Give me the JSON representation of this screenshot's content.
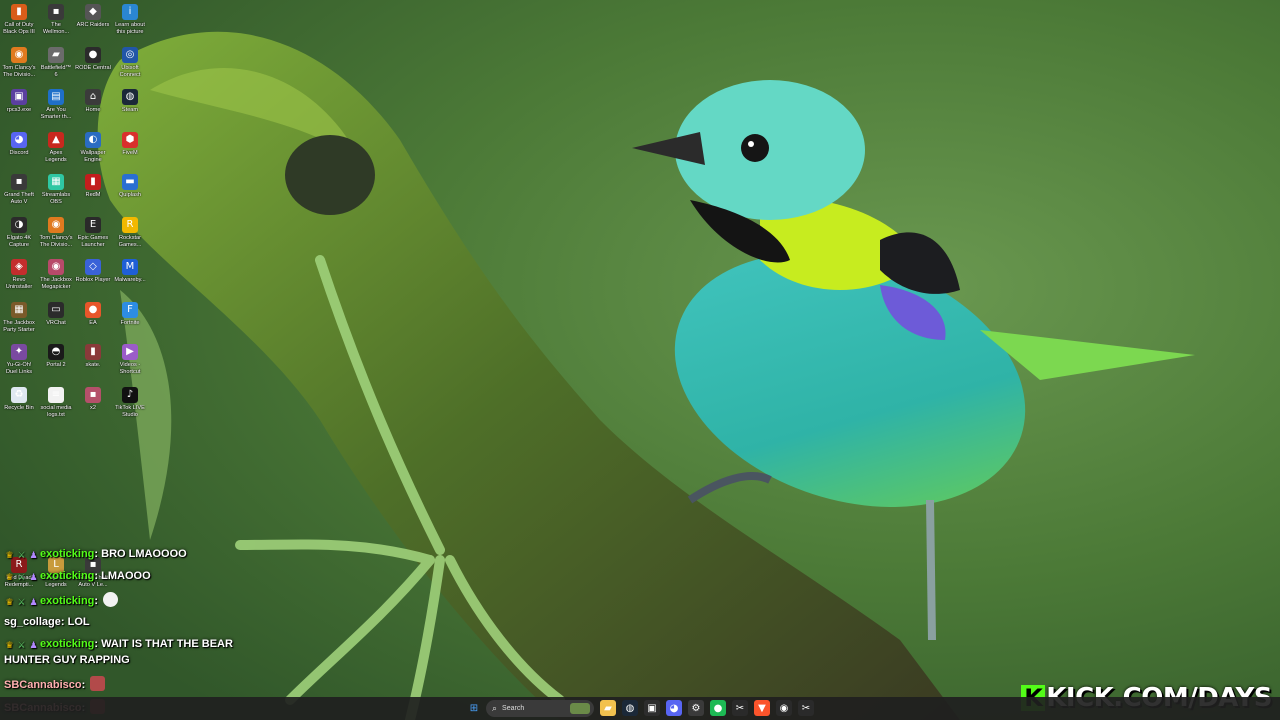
{
  "desktop": {
    "icons": [
      {
        "label": "Call of Duty\nBlack Ops III",
        "icon": "game-icon",
        "color": "#d95d1a",
        "glyph": "▮"
      },
      {
        "label": "The\nWellmon...",
        "icon": "app-icon",
        "color": "#3a3a3a",
        "glyph": "▪"
      },
      {
        "label": "ARC Raiders",
        "icon": "game-icon",
        "color": "#555555",
        "glyph": "◆"
      },
      {
        "label": "Learn about\nthis picture",
        "icon": "info-icon",
        "color": "#2a86d1",
        "glyph": "i"
      },
      {
        "label": "Tom Clancy's\nThe Divisio...",
        "icon": "game-icon",
        "color": "#e07a1f",
        "glyph": "◉"
      },
      {
        "label": "Battlefield™\n6",
        "icon": "game-icon",
        "color": "#6b6b6b",
        "glyph": "▰"
      },
      {
        "label": "RODE Central",
        "icon": "microphone-icon",
        "color": "#2b2b2b",
        "glyph": "●"
      },
      {
        "label": "Ubisoft\nConnect",
        "icon": "ubisoft-icon",
        "color": "#2156a8",
        "glyph": "◎"
      },
      {
        "label": "rpcs3.exe",
        "icon": "app-icon",
        "color": "#5b3fa0",
        "glyph": "▣"
      },
      {
        "label": "Are You\nSmarter th...",
        "icon": "game-icon",
        "color": "#1f6fc9",
        "glyph": "▤"
      },
      {
        "label": "Home",
        "icon": "game-icon",
        "color": "#3b3b3b",
        "glyph": "⌂"
      },
      {
        "label": "Steam",
        "icon": "steam-icon",
        "color": "#1b2838",
        "glyph": "◍"
      },
      {
        "label": "Discord",
        "icon": "discord-icon",
        "color": "#5865f2",
        "glyph": "◕"
      },
      {
        "label": "Apex\nLegends",
        "icon": "game-icon",
        "color": "#c8281e",
        "glyph": "▲"
      },
      {
        "label": "Wallpaper\nEngine",
        "icon": "app-icon",
        "color": "#2a6cc2",
        "glyph": "◐"
      },
      {
        "label": "FiveM",
        "icon": "game-icon",
        "color": "#d9302c",
        "glyph": "⬢"
      },
      {
        "label": "Grand Theft\nAuto V",
        "icon": "game-icon",
        "color": "#3a3a3a",
        "glyph": "▪"
      },
      {
        "label": "Streamlabs\nOBS",
        "icon": "streamlabs-icon",
        "color": "#2fc7a3",
        "glyph": "▦"
      },
      {
        "label": "RedM",
        "icon": "game-icon",
        "color": "#c21d1d",
        "glyph": "▮"
      },
      {
        "label": "Quiplash",
        "icon": "game-icon",
        "color": "#2a6fd1",
        "glyph": "▬"
      },
      {
        "label": "Elgato 4K\nCapture",
        "icon": "camera-icon",
        "color": "#2b2b2b",
        "glyph": "◑"
      },
      {
        "label": "Tom Clancy's\nThe Divisio...",
        "icon": "game-icon",
        "color": "#e07a1f",
        "glyph": "◉"
      },
      {
        "label": "Epic Games\nLauncher",
        "icon": "epic-icon",
        "color": "#2a2a2a",
        "glyph": "E"
      },
      {
        "label": "Rockstar\nGames...",
        "icon": "rockstar-icon",
        "color": "#f2b800",
        "glyph": "R"
      },
      {
        "label": "Revo\nUninstaller",
        "icon": "app-icon",
        "color": "#c42d2d",
        "glyph": "◈"
      },
      {
        "label": "The Jackbox\nMegapicker",
        "icon": "game-icon",
        "color": "#b84a6a",
        "glyph": "◉"
      },
      {
        "label": "Roblox Player",
        "icon": "roblox-icon",
        "color": "#3a62d8",
        "glyph": "◇"
      },
      {
        "label": "Malwareby...",
        "icon": "shield-icon",
        "color": "#1f5fd6",
        "glyph": "M"
      },
      {
        "label": "The Jackbox\nParty Starter",
        "icon": "game-icon",
        "color": "#7a5a2a",
        "glyph": "▦"
      },
      {
        "label": "VRChat",
        "icon": "vr-icon",
        "color": "#2b2b2b",
        "glyph": "▭"
      },
      {
        "label": "EA",
        "icon": "ea-icon",
        "color": "#e8562a",
        "glyph": "●"
      },
      {
        "label": "Fortnite",
        "icon": "game-icon",
        "color": "#2d8de3",
        "glyph": "F"
      },
      {
        "label": "Yu-Gi-Oh!\nDuel Links",
        "icon": "game-icon",
        "color": "#7a4aa0",
        "glyph": "✦"
      },
      {
        "label": "Portal 2",
        "icon": "game-icon",
        "color": "#1a1a1a",
        "glyph": "◓"
      },
      {
        "label": "skate.",
        "icon": "game-icon",
        "color": "#8a3a3a",
        "glyph": "▮"
      },
      {
        "label": "Videos -\nShortcut",
        "icon": "folder-icon",
        "color": "#9b5cc9",
        "glyph": "▶"
      },
      {
        "label": "Recycle Bin",
        "icon": "recycle-bin-icon",
        "color": "#dfe8f1",
        "glyph": "♻"
      },
      {
        "label": "social media\nlogs.txt",
        "icon": "text-file-icon",
        "color": "#f2f2f2",
        "glyph": "≡"
      },
      {
        "label": "x2",
        "icon": "photo-icon",
        "color": "#b4506a",
        "glyph": "▪"
      },
      {
        "label": "TikTok LIVE\nStudio",
        "icon": "tiktok-icon",
        "color": "#111111",
        "glyph": "♪"
      },
      {
        "label": "Red Dead\nRedempti...",
        "icon": "game-icon",
        "color": "#8b1a1a",
        "glyph": "R"
      },
      {
        "label": "League of\nLegends",
        "icon": "game-icon",
        "color": "#c89b3c",
        "glyph": "L"
      },
      {
        "label": "Grand Theft\nAuto V Le...",
        "icon": "game-icon",
        "color": "#3a3a3a",
        "glyph": "▪"
      }
    ]
  },
  "chat": {
    "messages": [
      {
        "badges": [
          "crown-badge",
          "sword-badge",
          "sub-badge"
        ],
        "user": "exoticking",
        "user_color": "green",
        "text": "BRO LMAOOOO",
        "emote": null
      },
      {
        "badges": [
          "crown-badge",
          "sword-badge",
          "sub-badge"
        ],
        "user": "exoticking",
        "user_color": "green",
        "text": "LMAOOO",
        "emote": null
      },
      {
        "badges": [
          "crown-badge",
          "sword-badge",
          "sub-badge"
        ],
        "user": "exoticking",
        "user_color": "green",
        "text": "",
        "emote": "ghost-emote"
      },
      {
        "badges": [],
        "user": "sg_collage",
        "user_color": "plain",
        "text": "LOL",
        "emote": null
      },
      {
        "badges": [
          "crown-badge",
          "sword-badge",
          "sub-badge"
        ],
        "user": "exoticking",
        "user_color": "green",
        "text": "WAIT IS THAT THE BEAR",
        "text2": "HUNTER GUY RAPPING",
        "emote": null
      },
      {
        "badges": [],
        "user": "SBCannabisco",
        "user_color": "red",
        "text": "",
        "emote": "face-emote"
      },
      {
        "badges": [],
        "user": "SBCannabisco",
        "user_color": "red",
        "text": "",
        "emote": "face-emote"
      }
    ]
  },
  "watermark": {
    "kick_letter": "K",
    "text": "KICK.COM/DAYS",
    "brand_color": "#53fc18"
  },
  "taskbar": {
    "start": {
      "icon": "windows-start-icon",
      "glyph": "⊞",
      "color": "#4aa3ff"
    },
    "search": {
      "label": "Search",
      "icon": "search-icon",
      "glyph": "⌕"
    },
    "apps": [
      {
        "name": "file-explorer-icon",
        "glyph": "▰",
        "color": "#f2c14e"
      },
      {
        "name": "steam-icon",
        "glyph": "◍",
        "color": "#1b2838"
      },
      {
        "name": "app-icon",
        "glyph": "▣",
        "color": "#2d2d2d"
      },
      {
        "name": "discord-icon",
        "glyph": "◕",
        "color": "#5865f2"
      },
      {
        "name": "settings-icon",
        "glyph": "⚙",
        "color": "#3a3a3a"
      },
      {
        "name": "spotify-icon",
        "glyph": "●",
        "color": "#1db954"
      },
      {
        "name": "capcut-icon",
        "glyph": "✂",
        "color": "#2a2a2a"
      },
      {
        "name": "brave-icon",
        "glyph": "▼",
        "color": "#fb542b"
      },
      {
        "name": "obs-icon",
        "glyph": "◉",
        "color": "#2a2a2a"
      },
      {
        "name": "app-icon",
        "glyph": "✂",
        "color": "#2a2a2a"
      }
    ]
  }
}
